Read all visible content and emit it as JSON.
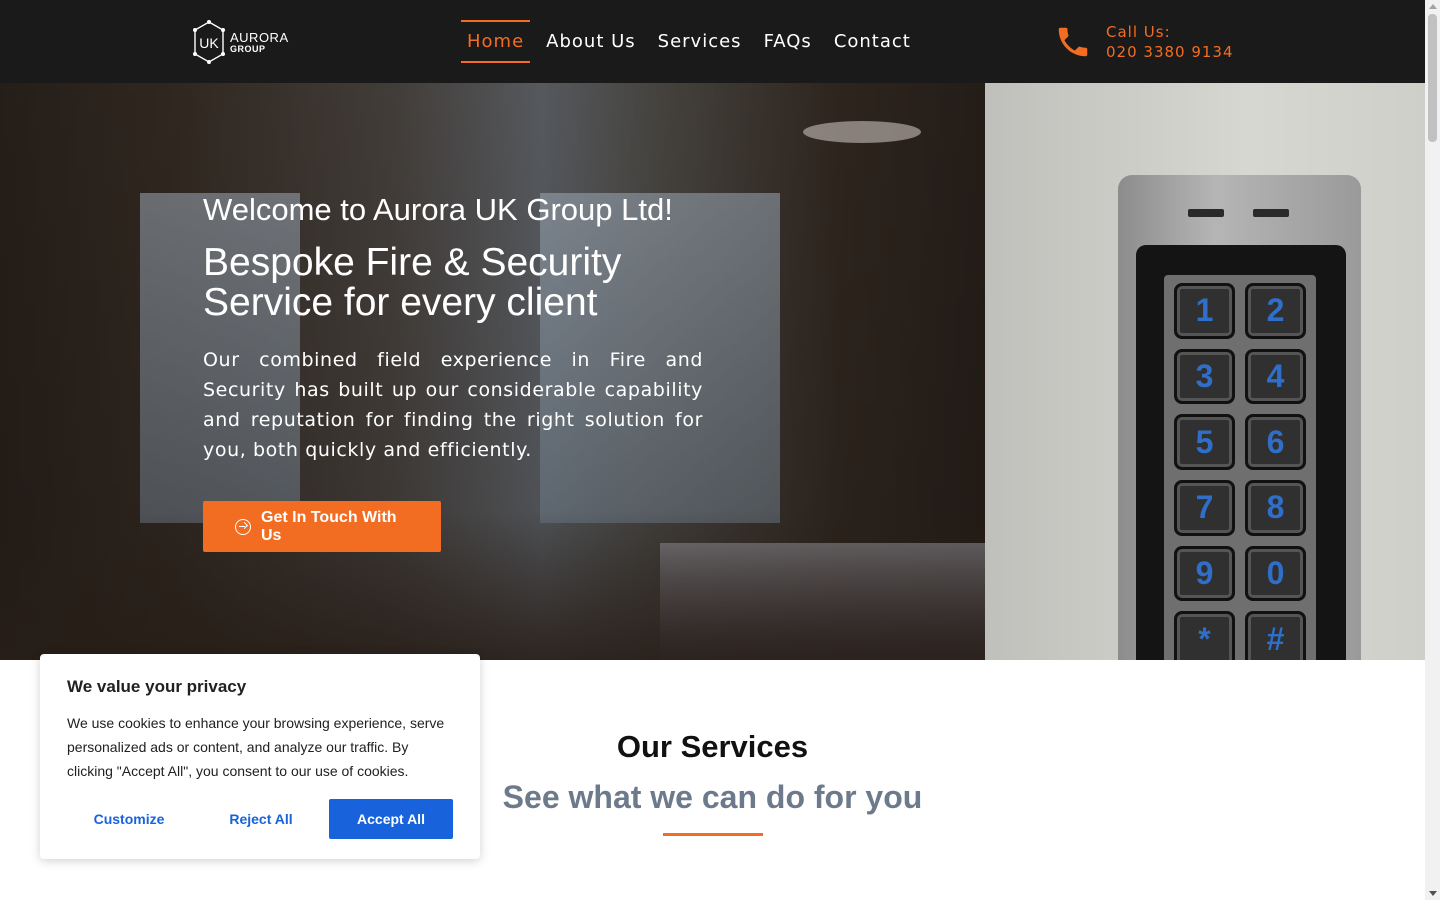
{
  "header": {
    "logo": {
      "mark": "UK",
      "word1": "AURORA",
      "word2": "GROUP"
    },
    "nav": [
      {
        "label": "Home",
        "active": true
      },
      {
        "label": "About Us",
        "active": false
      },
      {
        "label": "Services",
        "active": false
      },
      {
        "label": "FAQs",
        "active": false
      },
      {
        "label": "Contact",
        "active": false
      }
    ],
    "call": {
      "icon": "phone-icon",
      "label": "Call Us:",
      "number": "020 3380 9134"
    }
  },
  "hero": {
    "welcome": "Welcome to Aurora UK Group Ltd!",
    "tagline_line1": "Bespoke Fire & Security",
    "tagline_line2": "Service for every client",
    "description": "Our combined field experience in Fire and Security has built up our considerable capability and reputation for finding the right solution for you, both quickly and efficiently.",
    "cta": {
      "label": "Get In Touch With Us",
      "icon": "arrow-circle-right-icon"
    },
    "keypad_keys": [
      "1",
      "2",
      "3",
      "4",
      "5",
      "6",
      "7",
      "8",
      "9",
      "0",
      "*",
      "#"
    ]
  },
  "services": {
    "title": "Our Services",
    "subtitle": "See what we can do for you"
  },
  "cookie": {
    "title": "We value your privacy",
    "text": "We use cookies to enhance your browsing experience, serve personalized ads or content, and analyze our traffic. By clicking \"Accept All\", you consent to our use of cookies.",
    "customize": "Customize",
    "reject": "Reject All",
    "accept": "Accept All"
  },
  "colors": {
    "accent": "#f26d21",
    "header_bg": "#1a1a1a",
    "cookie_button": "#1863dc",
    "subtitle": "#6c7a8c"
  }
}
